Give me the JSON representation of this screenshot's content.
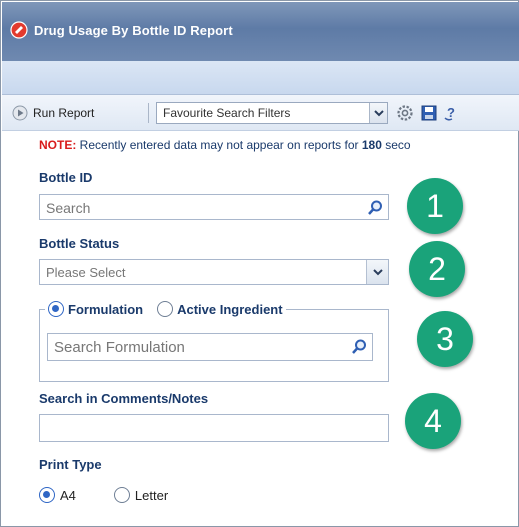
{
  "window": {
    "title": "Drug Usage By Bottle ID Report"
  },
  "toolbar": {
    "run_label": "Run Report",
    "favourite_select_value": "Favourite Search Filters"
  },
  "note": {
    "lead": "NOTE:",
    "text": " Recently entered data may not appear on reports for ",
    "number": "180",
    "tail": " seco"
  },
  "fields": {
    "bottle_id": {
      "label": "Bottle ID",
      "placeholder": "Search"
    },
    "bottle_status": {
      "label": "Bottle Status",
      "value": "Please Select"
    },
    "formulation_group": {
      "option_formulation": "Formulation",
      "option_active": "Active Ingredient",
      "selected": "Formulation",
      "placeholder": "Search Formulation"
    },
    "comments": {
      "label": "Search in Comments/Notes",
      "value": ""
    },
    "print_type": {
      "label": "Print Type",
      "option_a4": "A4",
      "option_letter": "Letter",
      "selected": "A4"
    }
  },
  "badges": [
    "1",
    "2",
    "3",
    "4"
  ],
  "colors": {
    "badge": "#1aa37a",
    "title_bar": "#6f89b0",
    "note_lead": "#d81b1b",
    "label_text": "#1a3a6b"
  },
  "icons": [
    "report-icon",
    "play-icon",
    "gear-icon",
    "save-icon",
    "help-icon",
    "search-icon",
    "chevron-down-icon"
  ]
}
